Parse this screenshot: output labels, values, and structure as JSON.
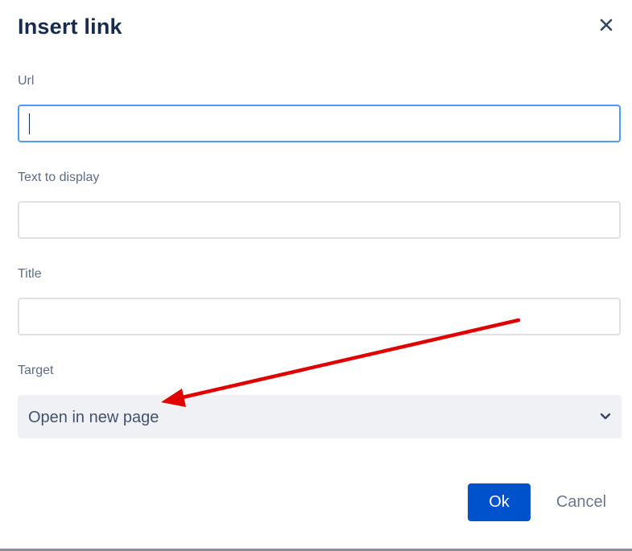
{
  "dialog": {
    "title": "Insert link",
    "close_icon": "close-icon"
  },
  "fields": {
    "url": {
      "label": "Url",
      "value": "",
      "placeholder": ""
    },
    "text_to_display": {
      "label": "Text to display",
      "value": "",
      "placeholder": ""
    },
    "title": {
      "label": "Title",
      "value": "",
      "placeholder": ""
    },
    "target": {
      "label": "Target",
      "selected": "Open in new page",
      "icon": "chevron-down-icon"
    }
  },
  "actions": {
    "ok_label": "Ok",
    "cancel_label": "Cancel"
  },
  "colors": {
    "primary": "#0052cc",
    "title_text": "#172b4d",
    "label_text": "#5e6c84",
    "focus_border": "#4c9aff",
    "annotation_arrow": "#e00000"
  }
}
